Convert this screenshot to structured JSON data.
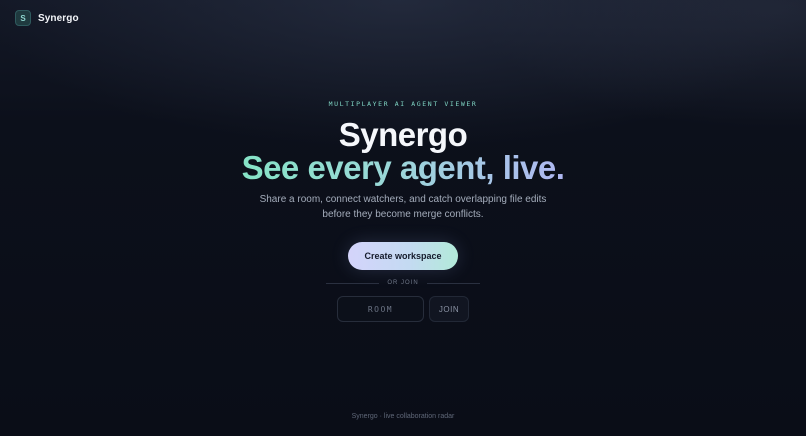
{
  "brand": {
    "logo_letter": "S",
    "name": "Synergo",
    "logo_icon": "app-logo-square",
    "accent": "#7fd4c3"
  },
  "hero": {
    "eyebrow": "MULTIPLAYER AI AGENT VIEWER",
    "title": "Synergo",
    "tagline": "See every agent, live.",
    "description": "Share a room, connect watchers, and catch overlapping file edits before they become merge conflicts."
  },
  "actions": {
    "create_label": "Create workspace",
    "divider_label": "OR JOIN",
    "room_placeholder": "ROOM",
    "room_value": "",
    "join_label": "JOIN"
  },
  "footer": {
    "text": "Synergo · live collaboration radar"
  },
  "colors": {
    "background": "#0b0f1a",
    "cta_gradient_start": "#d4d4fb",
    "cta_gradient_end": "#b2ead9",
    "tagline_gradient_start": "#86e3c6",
    "tagline_gradient_end": "#b0b8f2"
  }
}
